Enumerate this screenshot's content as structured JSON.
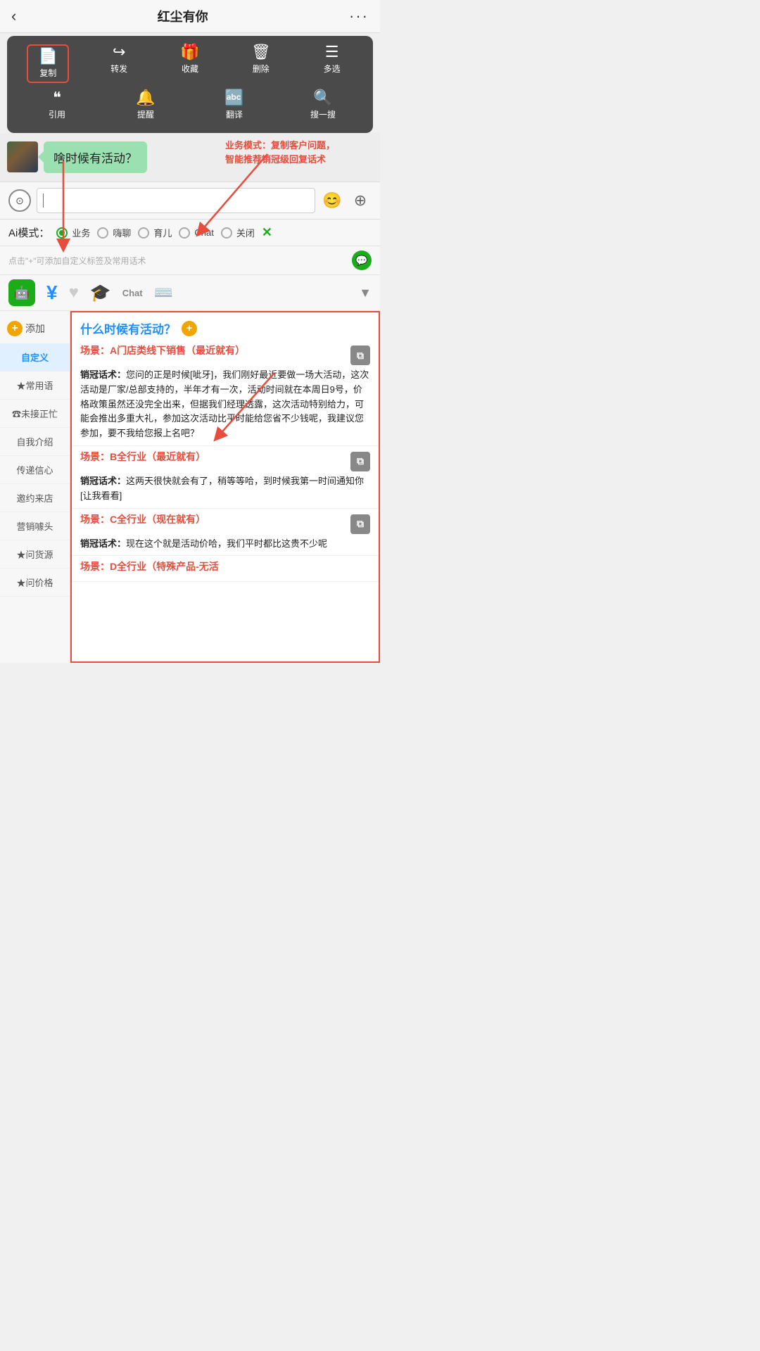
{
  "header": {
    "back": "‹",
    "title": "红尘有你",
    "more": "···"
  },
  "context_menu": {
    "row1": [
      {
        "icon": "📄",
        "label": "复制",
        "highlighted": true
      },
      {
        "icon": "↪",
        "label": "转发",
        "highlighted": false
      },
      {
        "icon": "🎁",
        "label": "收藏",
        "highlighted": false
      },
      {
        "icon": "🗑",
        "label": "删除",
        "highlighted": false
      },
      {
        "icon": "☰",
        "label": "多选",
        "highlighted": false
      }
    ],
    "row2": [
      {
        "icon": "❝",
        "label": "引用",
        "highlighted": false
      },
      {
        "icon": "🔔",
        "label": "提醒",
        "highlighted": false
      },
      {
        "icon": "A→",
        "label": "翻译",
        "highlighted": false
      },
      {
        "icon": "🔍",
        "label": "搜一搜",
        "highlighted": false
      }
    ]
  },
  "chat": {
    "bubble_text": "啥时候有活动？"
  },
  "annotation": {
    "text": "业务模式：复制客户问题，\n智能推荐销冠级回复话术"
  },
  "input": {
    "placeholder": "",
    "voice_icon": "⊙",
    "emoji_icon": "😊",
    "plus_icon": "+"
  },
  "ai_mode": {
    "label": "Ai模式：",
    "options": [
      {
        "label": "业务",
        "active": true
      },
      {
        "label": "嗨聊",
        "active": false
      },
      {
        "label": "育儿",
        "active": false
      },
      {
        "label": "Chat",
        "active": false
      },
      {
        "label": "关闭",
        "active": false
      }
    ],
    "close": "✕"
  },
  "hint_row": {
    "text": "点击\"+\"可添加自定义标签及常用话术"
  },
  "toolbar": {
    "items": [
      {
        "icon": "🤖",
        "label": "bot",
        "active": true
      },
      {
        "icon": "¥",
        "label": "money",
        "active": false
      },
      {
        "icon": "♥",
        "label": "heart",
        "active": false
      },
      {
        "icon": "🎓",
        "label": "hat",
        "active": false
      },
      {
        "icon": "Chat",
        "label": "chat-text",
        "active": false
      },
      {
        "icon": "⌨",
        "label": "keyboard",
        "active": false
      }
    ],
    "arrow": "▼"
  },
  "sidebar": {
    "add_label": "添加",
    "items": [
      {
        "label": "自定义",
        "active": true
      },
      {
        "label": "★常用语",
        "active": false
      },
      {
        "label": "☎未接正忙",
        "active": false
      },
      {
        "label": "自我介绍",
        "active": false
      },
      {
        "label": "传递信心",
        "active": false
      },
      {
        "label": "邀约来店",
        "active": false
      },
      {
        "label": "营销噱头",
        "active": false
      },
      {
        "label": "★问货源",
        "active": false
      },
      {
        "label": "★问价格",
        "active": false
      }
    ]
  },
  "content": {
    "title": "什么时候有活动？",
    "scenes": [
      {
        "id": "A",
        "scene_label": "场景：A门店类线下销售（最近就有）",
        "content_label": "销冠话术：",
        "content_text": "您问的正是时候[呲牙]，我们刚好最近要做一场大活动，这次活动是厂家/总部支持的，半年才有一次，活动时间就在本周日9号，价格政策虽然还没完全出来，但据我们经理透露，这次活动特别给力，可能会推出多重大礼，参加这次活动比平时能给您省不少钱呢，我建议您参加，要不我给您报上名吧？"
      },
      {
        "id": "B",
        "scene_label": "场景：B全行业（最近就有）",
        "content_label": "销冠话术：",
        "content_text": "这两天很快就会有了，稍等等哈，到时候我第一时间通知你[让我看看]"
      },
      {
        "id": "C",
        "scene_label": "场景：C全行业（现在就有）",
        "content_label": "销冠话术：",
        "content_text": "现在这个就是活动价哈，我们平时都比这贵不少呢"
      },
      {
        "id": "D",
        "scene_label": "场景：D全行业（特殊产品-无活",
        "content_label": "",
        "content_text": ""
      }
    ]
  }
}
